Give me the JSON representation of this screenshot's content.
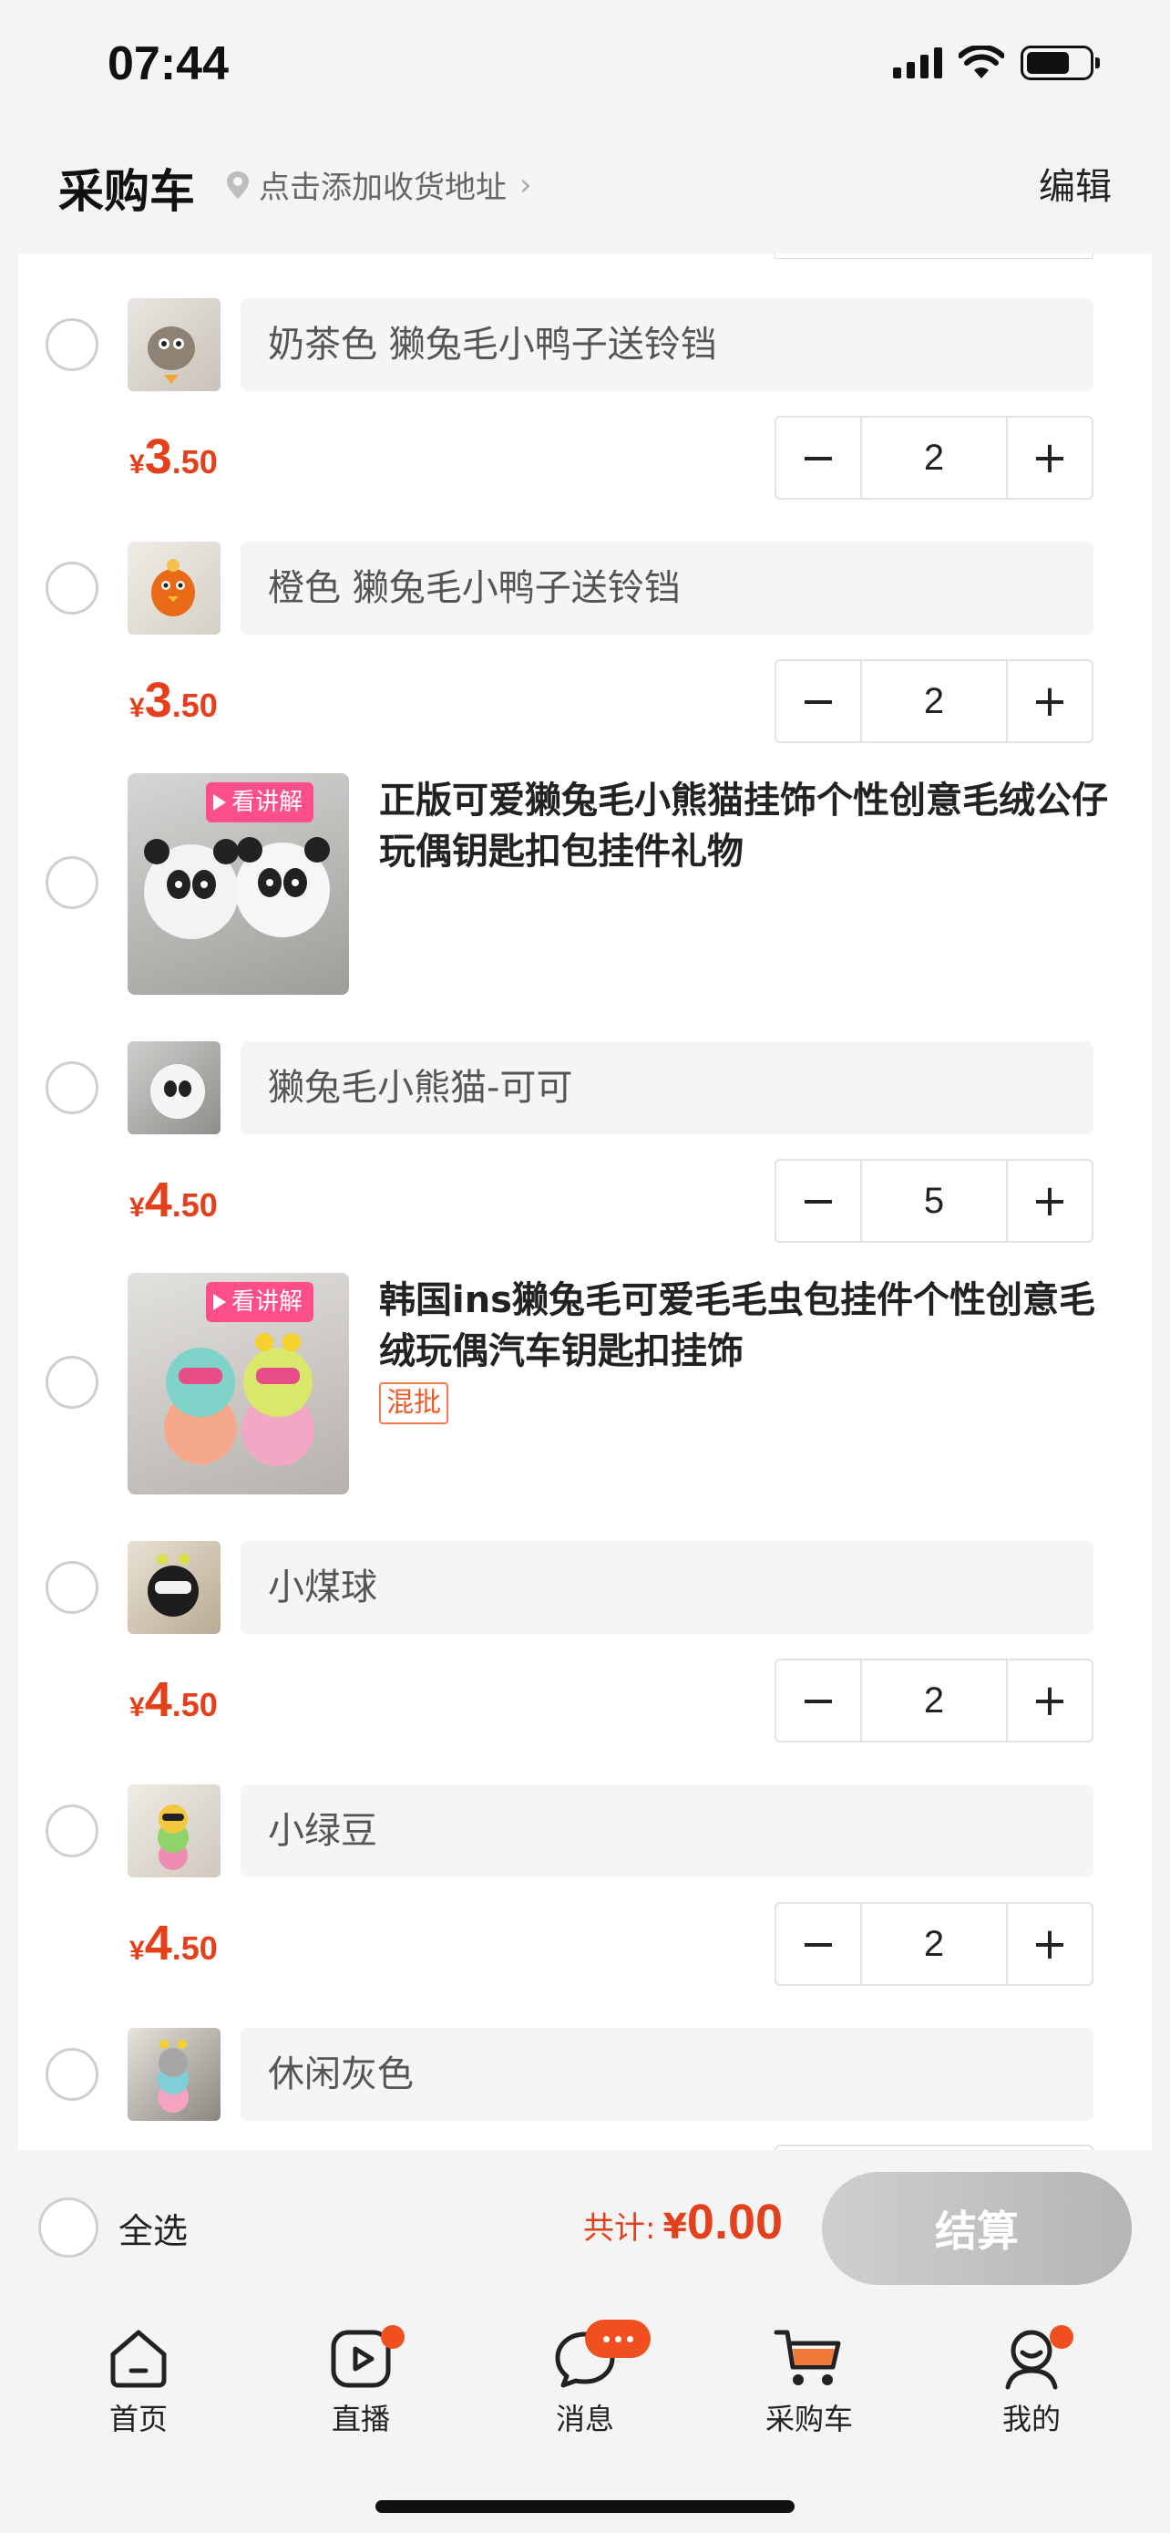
{
  "status_bar": {
    "time": "07:44"
  },
  "header": {
    "title": "采购车",
    "address": "点击添加收货地址",
    "edit_label": "编辑"
  },
  "colors": {
    "accent": "#e4401b",
    "badge": "#f0501f",
    "live_badge": "#ff4f8b"
  },
  "cart": {
    "sku1": {
      "spec": "奶茶色 獭兔毛小鸭子送铃铛",
      "price_cur": "¥",
      "price_int": "3",
      "price_dec": ".50",
      "qty": "2"
    },
    "sku2": {
      "spec": "橙色 獭兔毛小鸭子送铃铛",
      "price_cur": "¥",
      "price_int": "3",
      "price_dec": ".50",
      "qty": "2"
    },
    "product2": {
      "live_label": "看讲解",
      "title": "正版可爱獭兔毛小熊猫挂饰个性创意毛绒公仔玩偶钥匙扣包挂件礼物"
    },
    "sku3": {
      "spec": "獭兔毛小熊猫-可可",
      "price_cur": "¥",
      "price_int": "4",
      "price_dec": ".50",
      "qty": "5"
    },
    "product3": {
      "live_label": "看讲解",
      "title": "韩国ins獭兔毛可爱毛毛虫包挂件个性创意毛绒玩偶汽车钥匙扣挂饰",
      "tag": "混批"
    },
    "sku4": {
      "spec": "小煤球",
      "price_cur": "¥",
      "price_int": "4",
      "price_dec": ".50",
      "qty": "2"
    },
    "sku5": {
      "spec": "小绿豆",
      "price_cur": "¥",
      "price_int": "4",
      "price_dec": ".50",
      "qty": "2"
    },
    "sku6": {
      "spec": "休闲灰色"
    }
  },
  "stepper": {
    "minus": "−",
    "plus": "+"
  },
  "footer": {
    "select_all": "全选",
    "total_label": "共计:",
    "total_cur": "¥",
    "total_amount": "0.00",
    "checkout": "结算"
  },
  "tabbar": {
    "home": "首页",
    "live": "直播",
    "messages": "消息",
    "cart": "采购车",
    "me": "我的"
  }
}
